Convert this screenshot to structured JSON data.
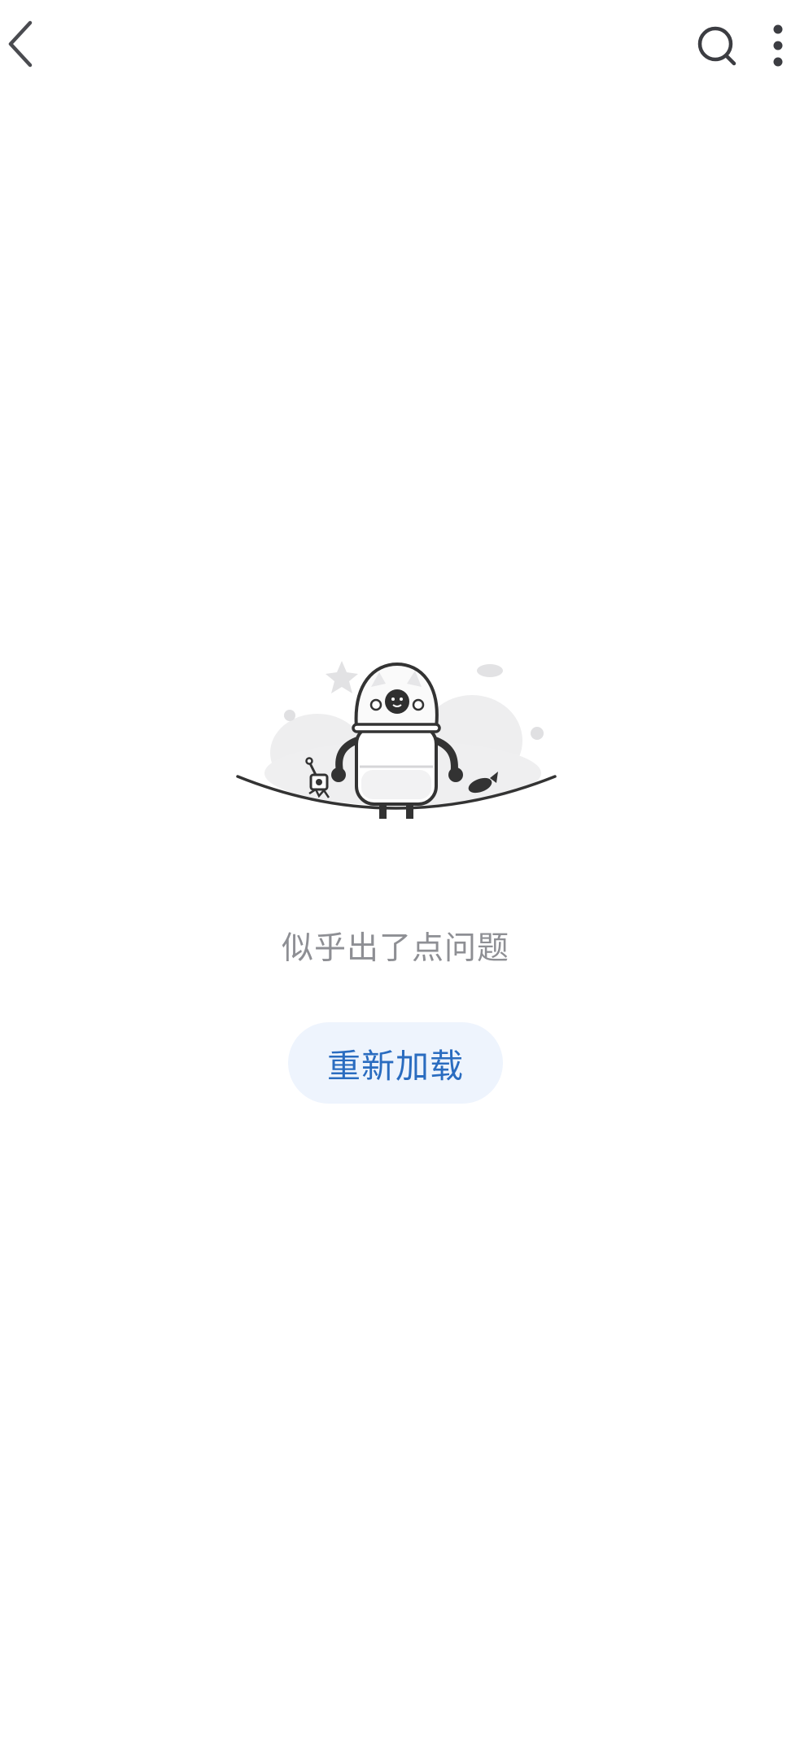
{
  "header": {
    "back_icon": "chevron-left-icon",
    "search_icon": "search-icon",
    "more_icon": "more-vertical-icon"
  },
  "error": {
    "illustration": "robot-astronaut-error-illustration",
    "message": "似乎出了点问题",
    "reload_label": "重新加载"
  },
  "colors": {
    "icon": "#3c3d42",
    "message": "#8e8f94",
    "button_bg": "#eef4fd",
    "button_text": "#2a6cc0"
  }
}
